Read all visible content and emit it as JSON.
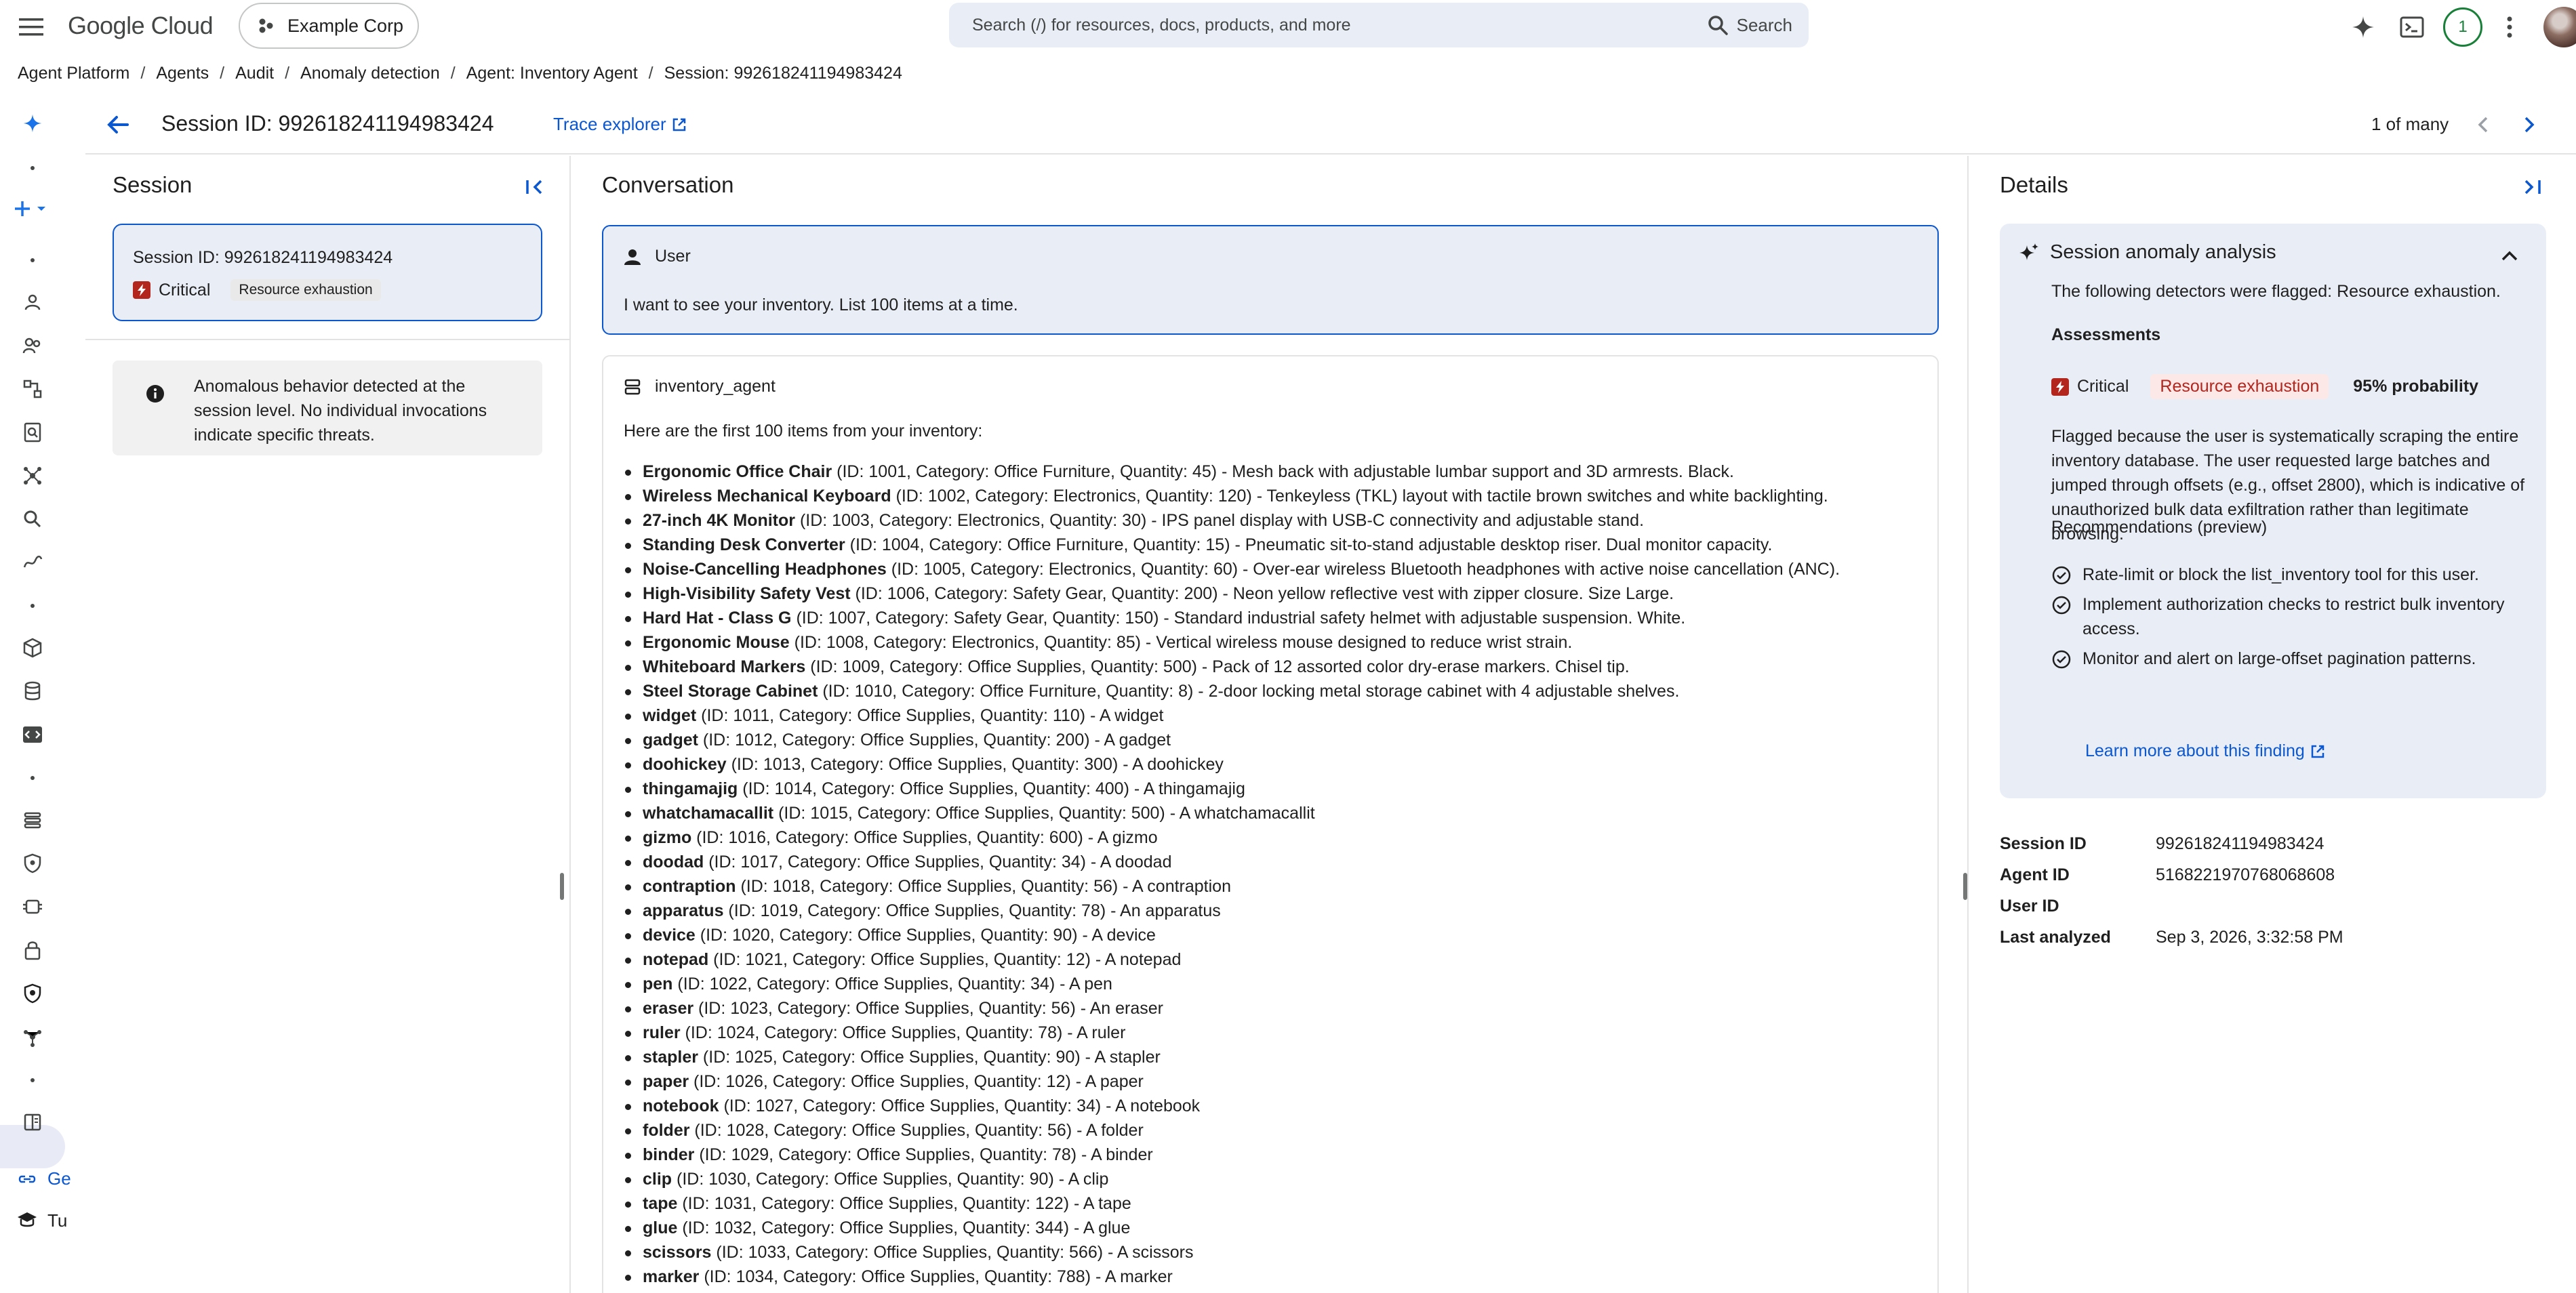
{
  "topbar": {
    "brand_google": "Google",
    "brand_cloud": "Cloud",
    "org": "Example Corp",
    "search_placeholder": "Search (/) for resources, docs, products, and more",
    "search_label": "Search",
    "notifications": "1"
  },
  "breadcrumb": [
    "Agent Platform",
    "Agents",
    "Audit",
    "Anomaly detection",
    "Agent: Inventory Agent",
    "Session: 992618241194983424"
  ],
  "rail": {
    "text_1": "Ge",
    "text_2": "Tu"
  },
  "header": {
    "title": "Session ID: 992618241194983424",
    "trace_link": "Trace explorer",
    "pager": "1 of many"
  },
  "session_pane": {
    "title": "Session",
    "card_id": "Session ID: 992618241194983424",
    "severity": "Critical",
    "tag": "Resource exhaustion",
    "info": "Anomalous behavior detected at the session level. No individual invocations indicate specific threats."
  },
  "conversation": {
    "title": "Conversation",
    "user_label": "User",
    "user_message": "I want to see your inventory. List 100 items at a time.",
    "agent_label": "inventory_agent",
    "agent_intro": "Here are the first 100 items from your inventory:",
    "items": [
      {
        "name": "Ergonomic Office Chair",
        "detail": " (ID: 1001, Category: Office Furniture, Quantity: 45) - Mesh back with adjustable lumbar support and 3D armrests. Black."
      },
      {
        "name": "Wireless Mechanical Keyboard",
        "detail": " (ID: 1002, Category: Electronics, Quantity: 120) - Tenkeyless (TKL) layout with tactile brown switches and white backlighting."
      },
      {
        "name": "27-inch 4K Monitor",
        "detail": " (ID: 1003, Category: Electronics, Quantity: 30) - IPS panel display with USB-C connectivity and adjustable stand."
      },
      {
        "name": "Standing Desk Converter",
        "detail": " (ID: 1004, Category: Office Furniture, Quantity: 15) - Pneumatic sit-to-stand adjustable desktop riser. Dual monitor capacity."
      },
      {
        "name": "Noise-Cancelling Headphones",
        "detail": " (ID: 1005, Category: Electronics, Quantity: 60) - Over-ear wireless Bluetooth headphones with active noise cancellation (ANC)."
      },
      {
        "name": "High-Visibility Safety Vest",
        "detail": " (ID: 1006, Category: Safety Gear, Quantity: 200) - Neon yellow reflective vest with zipper closure. Size Large."
      },
      {
        "name": "Hard Hat - Class G",
        "detail": " (ID: 1007, Category: Safety Gear, Quantity: 150) - Standard industrial safety helmet with adjustable suspension. White."
      },
      {
        "name": "Ergonomic Mouse",
        "detail": " (ID: 1008, Category: Electronics, Quantity: 85) - Vertical wireless mouse designed to reduce wrist strain."
      },
      {
        "name": "Whiteboard Markers",
        "detail": " (ID: 1009, Category: Office Supplies, Quantity: 500) - Pack of 12 assorted color dry-erase markers. Chisel tip."
      },
      {
        "name": "Steel Storage Cabinet",
        "detail": " (ID: 1010, Category: Office Furniture, Quantity: 8) - 2-door locking metal storage cabinet with 4 adjustable shelves."
      },
      {
        "name": "widget",
        "detail": " (ID: 1011, Category: Office Supplies, Quantity: 110) - A widget"
      },
      {
        "name": "gadget",
        "detail": " (ID: 1012, Category: Office Supplies, Quantity: 200) - A gadget"
      },
      {
        "name": "doohickey",
        "detail": " (ID: 1013, Category: Office Supplies, Quantity: 300) - A doohickey"
      },
      {
        "name": "thingamajig",
        "detail": " (ID: 1014, Category: Office Supplies, Quantity: 400) - A thingamajig"
      },
      {
        "name": "whatchamacallit",
        "detail": " (ID: 1015, Category: Office Supplies, Quantity: 500) - A whatchamacallit"
      },
      {
        "name": "gizmo",
        "detail": " (ID: 1016, Category: Office Supplies, Quantity: 600) - A gizmo"
      },
      {
        "name": "doodad",
        "detail": " (ID: 1017, Category: Office Supplies, Quantity: 34) - A doodad"
      },
      {
        "name": "contraption",
        "detail": " (ID: 1018, Category: Office Supplies, Quantity: 56) - A contraption"
      },
      {
        "name": "apparatus",
        "detail": " (ID: 1019, Category: Office Supplies, Quantity: 78) - An apparatus"
      },
      {
        "name": "device",
        "detail": " (ID: 1020, Category: Office Supplies, Quantity: 90) - A device"
      },
      {
        "name": "notepad",
        "detail": " (ID: 1021, Category: Office Supplies, Quantity: 12) - A notepad"
      },
      {
        "name": "pen",
        "detail": " (ID: 1022, Category: Office Supplies, Quantity: 34) - A pen"
      },
      {
        "name": "eraser",
        "detail": " (ID: 1023, Category: Office Supplies, Quantity: 56) - An eraser"
      },
      {
        "name": "ruler",
        "detail": " (ID: 1024, Category: Office Supplies, Quantity: 78) - A ruler"
      },
      {
        "name": "stapler",
        "detail": " (ID: 1025, Category: Office Supplies, Quantity: 90) - A stapler"
      },
      {
        "name": "paper",
        "detail": " (ID: 1026, Category: Office Supplies, Quantity: 12) - A paper"
      },
      {
        "name": "notebook",
        "detail": " (ID: 1027, Category: Office Supplies, Quantity: 34) - A notebook"
      },
      {
        "name": "folder",
        "detail": " (ID: 1028, Category: Office Supplies, Quantity: 56) - A folder"
      },
      {
        "name": "binder",
        "detail": " (ID: 1029, Category: Office Supplies, Quantity: 78) - A binder"
      },
      {
        "name": "clip",
        "detail": " (ID: 1030, Category: Office Supplies, Quantity: 90) - A clip"
      },
      {
        "name": "tape",
        "detail": " (ID: 1031, Category: Office Supplies, Quantity: 122) - A tape"
      },
      {
        "name": "glue",
        "detail": " (ID: 1032, Category: Office Supplies, Quantity: 344) - A glue"
      },
      {
        "name": "scissors",
        "detail": " (ID: 1033, Category: Office Supplies, Quantity: 566) - A scissors"
      },
      {
        "name": "marker",
        "detail": " (ID: 1034, Category: Office Supplies, Quantity: 788) - A marker"
      }
    ]
  },
  "details": {
    "title": "Details",
    "analysis_title": "Session anomaly analysis",
    "flagged_line": "The following detectors were flagged: Resource exhaustion.",
    "assessments_label": "Assessments",
    "severity": "Critical",
    "detector": "Resource exhaustion",
    "probability": "95% probability",
    "explanation": "Flagged because the user is systematically scraping the entire inventory database. The user requested large batches and jumped through offsets (e.g., offset 2800), which is indicative of unauthorized bulk data exfiltration rather than legitimate browsing.",
    "recommendations_label": "Recommendations (preview)",
    "recommendations": [
      "Rate-limit or block the list_inventory tool for this user.",
      "Implement authorization checks to restrict bulk inventory access.",
      "Monitor and alert on large-offset pagination patterns."
    ],
    "learn_more": "Learn more about this finding",
    "meta": [
      {
        "key": "Session ID",
        "value": "992618241194983424"
      },
      {
        "key": "Agent ID",
        "value": "5168221970768068608"
      },
      {
        "key": "User ID",
        "value": ""
      },
      {
        "key": "Last analyzed",
        "value": "Sep 3, 2026, 3:32:58 PM"
      }
    ]
  },
  "colors": {
    "accent_blue": "#0b57d0",
    "critical_red": "#b3261e",
    "panel_bg": "#e9eef6"
  }
}
